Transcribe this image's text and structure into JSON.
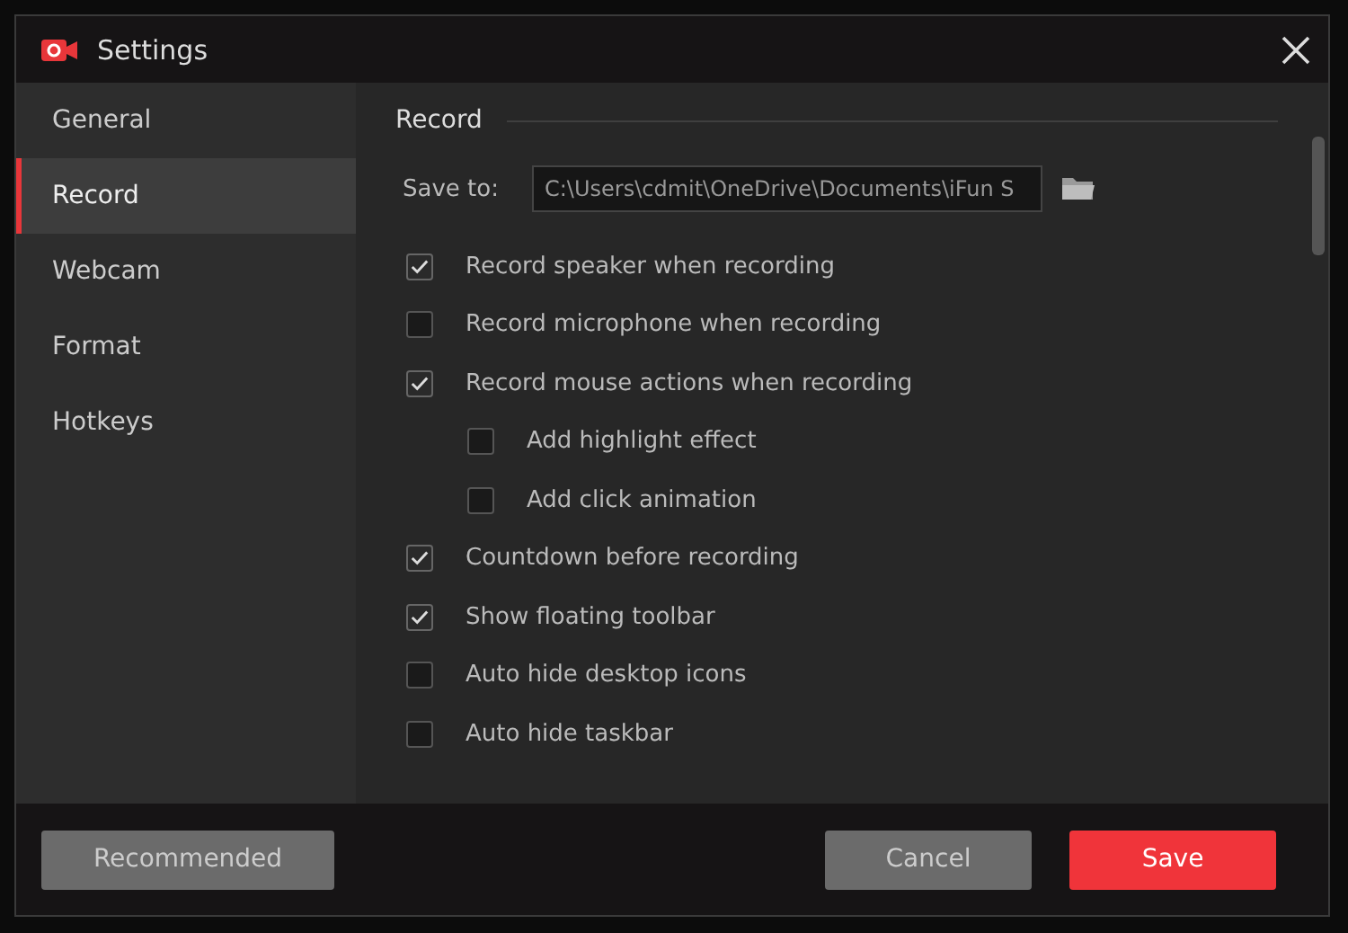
{
  "window": {
    "title": "Settings"
  },
  "sidebar": {
    "items": [
      {
        "label": "General",
        "selected": false
      },
      {
        "label": "Record",
        "selected": true
      },
      {
        "label": "Webcam",
        "selected": false
      },
      {
        "label": "Format",
        "selected": false
      },
      {
        "label": "Hotkeys",
        "selected": false
      }
    ]
  },
  "section": {
    "title": "Record"
  },
  "save_to": {
    "label": "Save to:",
    "value": "C:\\Users\\cdmit\\OneDrive\\Documents\\iFun S"
  },
  "options": [
    {
      "label": "Record speaker when recording",
      "checked": true
    },
    {
      "label": "Record microphone when recording",
      "checked": false
    },
    {
      "label": "Record mouse actions when recording",
      "checked": true,
      "children": [
        {
          "label": "Add highlight effect",
          "checked": false
        },
        {
          "label": "Add click animation",
          "checked": false
        }
      ]
    },
    {
      "label": "Countdown before recording",
      "checked": true
    },
    {
      "label": "Show floating toolbar",
      "checked": true
    },
    {
      "label": "Auto hide desktop icons",
      "checked": false
    },
    {
      "label": "Auto hide taskbar",
      "checked": false
    }
  ],
  "footer": {
    "recommended": "Recommended",
    "cancel": "Cancel",
    "save": "Save"
  }
}
